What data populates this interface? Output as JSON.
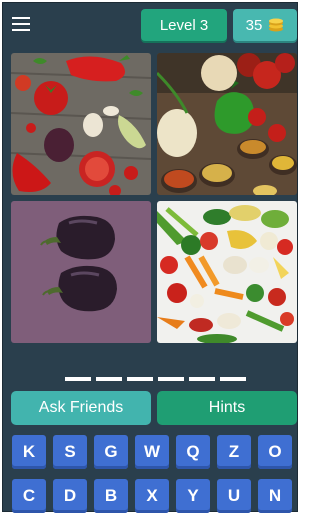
{
  "header": {
    "level_label": "Level 3",
    "coins": "35",
    "coin_icon": "coin-stack-icon",
    "menu_icon": "hamburger-menu-icon"
  },
  "pictures": [
    {
      "subject": "vegetables-on-wood"
    },
    {
      "subject": "vegetables-and-spices"
    },
    {
      "subject": "two-eggplants"
    },
    {
      "subject": "vegetable-assortment"
    }
  ],
  "answer": {
    "slot_count": 6,
    "letters": [
      "",
      "",
      "",
      "",
      "",
      ""
    ]
  },
  "buttons": {
    "ask_friends": "Ask Friends",
    "hints": "Hints"
  },
  "keyboard": [
    "K",
    "S",
    "G",
    "W",
    "Q",
    "Z",
    "O",
    "C",
    "D",
    "B",
    "X",
    "Y",
    "U",
    "N"
  ],
  "colors": {
    "background": "#2a3f4d",
    "level_pill": "#22a57d",
    "coin_pill": "#48b8b0",
    "ask_button": "#42b4ae",
    "hints_button": "#1f9e73",
    "key": "#3f6fd2"
  }
}
